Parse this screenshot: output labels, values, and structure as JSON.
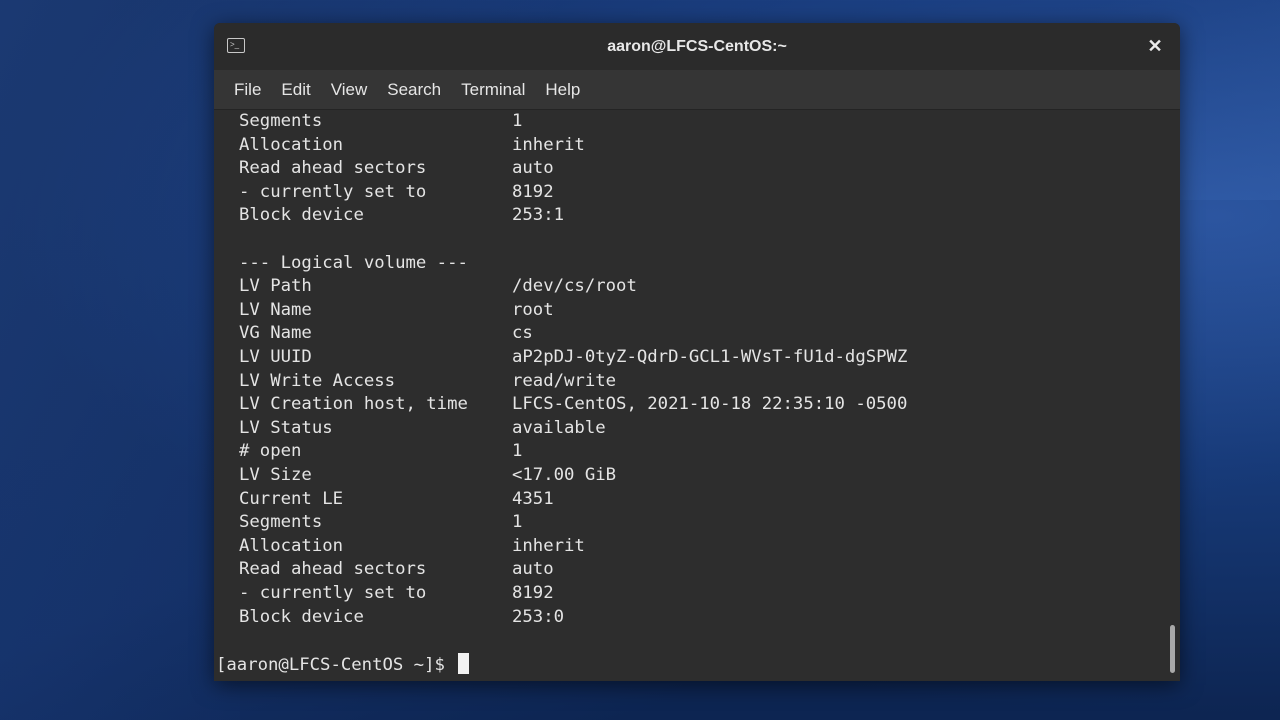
{
  "window": {
    "title": "aaron@LFCS-CentOS:~",
    "close_label": "✕",
    "icon_glyph": "⌨"
  },
  "menu": [
    "File",
    "Edit",
    "View",
    "Search",
    "Terminal",
    "Help"
  ],
  "terminal": {
    "lines": [
      {
        "key": "Segments",
        "value": "1"
      },
      {
        "key": "Allocation",
        "value": "inherit"
      },
      {
        "key": "Read ahead sectors",
        "value": "auto"
      },
      {
        "key": "- currently set to",
        "value": "8192"
      },
      {
        "key": "Block device",
        "value": "253:1"
      },
      {
        "key": "",
        "value": ""
      },
      {
        "key": "--- Logical volume ---",
        "value": ""
      },
      {
        "key": "LV Path",
        "value": "/dev/cs/root"
      },
      {
        "key": "LV Name",
        "value": "root"
      },
      {
        "key": "VG Name",
        "value": "cs"
      },
      {
        "key": "LV UUID",
        "value": "aP2pDJ-0tyZ-QdrD-GCL1-WVsT-fU1d-dgSPWZ"
      },
      {
        "key": "LV Write Access",
        "value": "read/write"
      },
      {
        "key": "LV Creation host, time",
        "value": "LFCS-CentOS, 2021-10-18 22:35:10 -0500"
      },
      {
        "key": "LV Status",
        "value": "available"
      },
      {
        "key": "# open",
        "value": "1"
      },
      {
        "key": "LV Size",
        "value": "<17.00 GiB"
      },
      {
        "key": "Current LE",
        "value": "4351"
      },
      {
        "key": "Segments",
        "value": "1"
      },
      {
        "key": "Allocation",
        "value": "inherit"
      },
      {
        "key": "Read ahead sectors",
        "value": "auto"
      },
      {
        "key": "- currently set to",
        "value": "8192"
      },
      {
        "key": "Block device",
        "value": "253:0"
      },
      {
        "key": "",
        "value": ""
      }
    ],
    "prompt": "[aaron@LFCS-CentOS ~]$ "
  }
}
